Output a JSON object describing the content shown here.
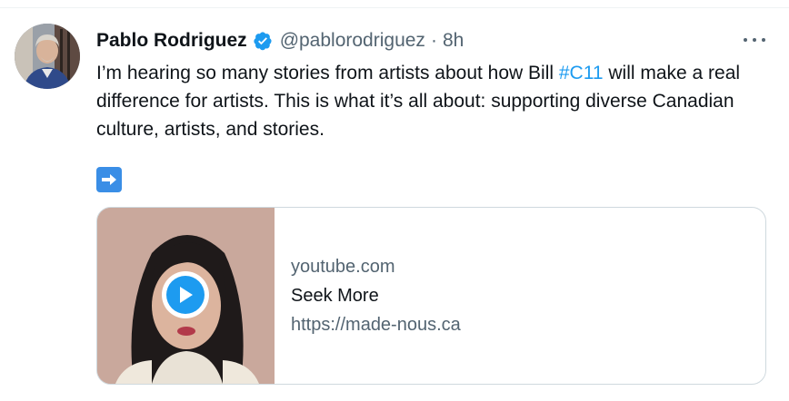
{
  "tweet": {
    "author_name": "Pablo Rodriguez",
    "handle": "@pablorodriguez",
    "separator": "·",
    "time": "8h",
    "text_before": "I’m hearing so many stories from artists about how Bill ",
    "hashtag": "#C11",
    "text_after": " will make a real difference for artists. This is what it’s all about: supporting diverse Canadian culture, artists, and stories.",
    "emoji": "right-arrow-emoji",
    "verified": true
  },
  "card": {
    "domain": "youtube.com",
    "title": "Seek More",
    "url": "https://made-nous.ca"
  },
  "colors": {
    "link": "#1d9bf0",
    "secondary_text": "#536471",
    "primary_text": "#0f1419",
    "border": "#cfd9de"
  }
}
